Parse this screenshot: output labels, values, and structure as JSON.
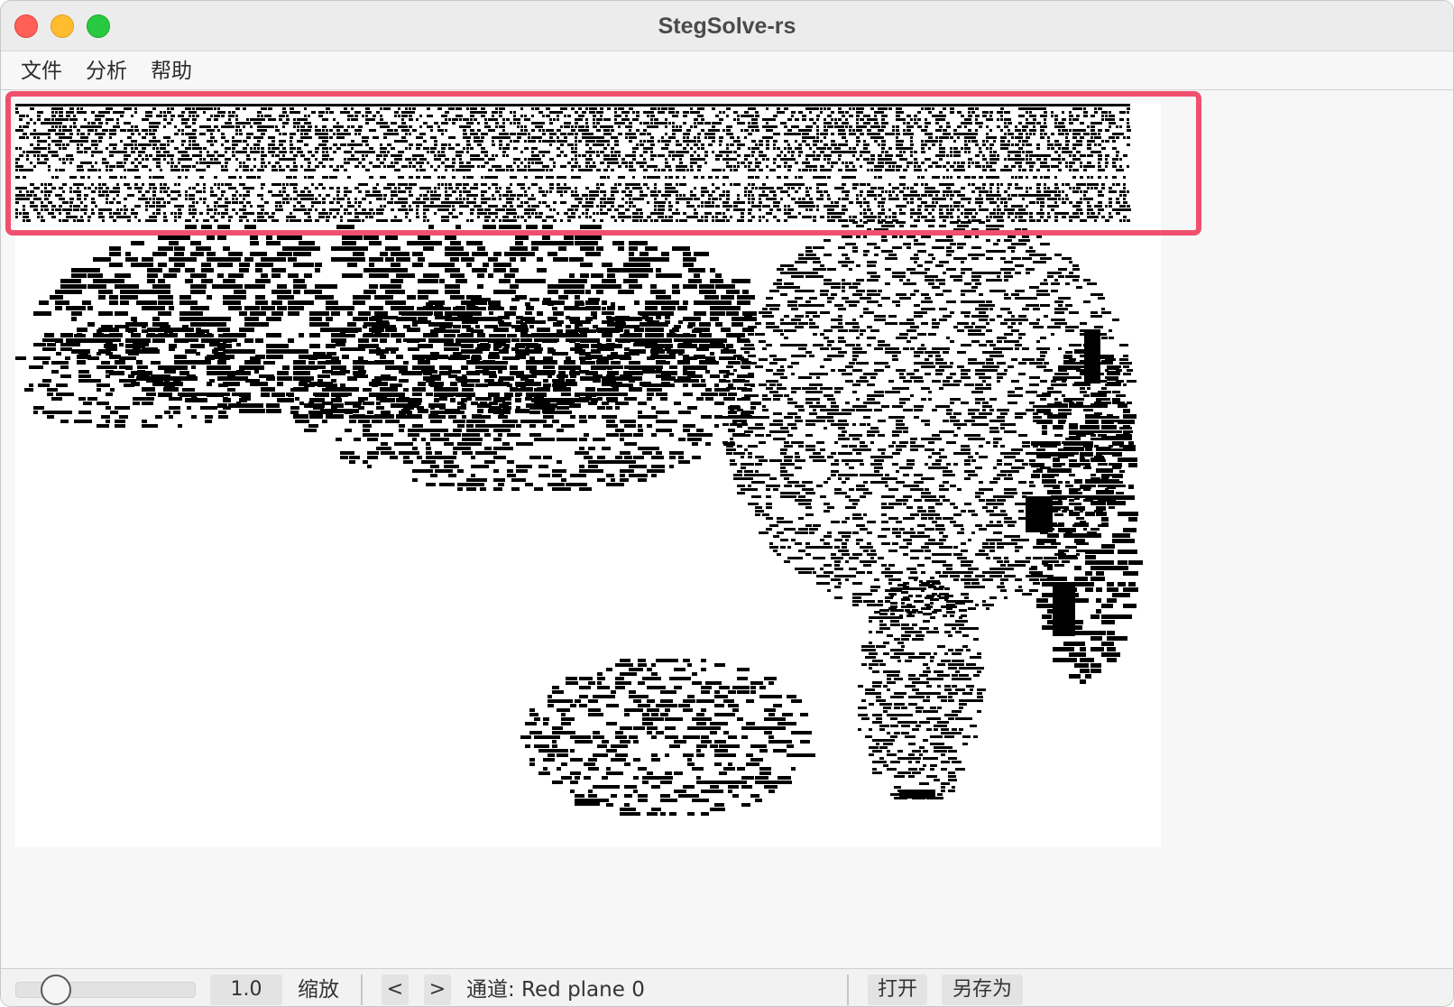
{
  "window": {
    "title": "StegSolve-rs"
  },
  "menu": {
    "file": "文件",
    "analyze": "分析",
    "help": "帮助"
  },
  "image": {
    "description_channel": "Red plane 0"
  },
  "toolbar": {
    "zoom_value": "1.0",
    "zoom_label": "缩放",
    "prev_label": "<",
    "next_label": ">",
    "channel_text": "通道: Red plane 0",
    "open_label": "打开",
    "save_as_label": "另存为"
  },
  "colors": {
    "highlight": "#f0506e",
    "close": "#fe5f57",
    "minimize": "#febc2e",
    "maximize": "#28c840"
  },
  "icons": {
    "close": "close-dot",
    "minimize": "minimize-dot",
    "maximize": "zoom-dot"
  }
}
